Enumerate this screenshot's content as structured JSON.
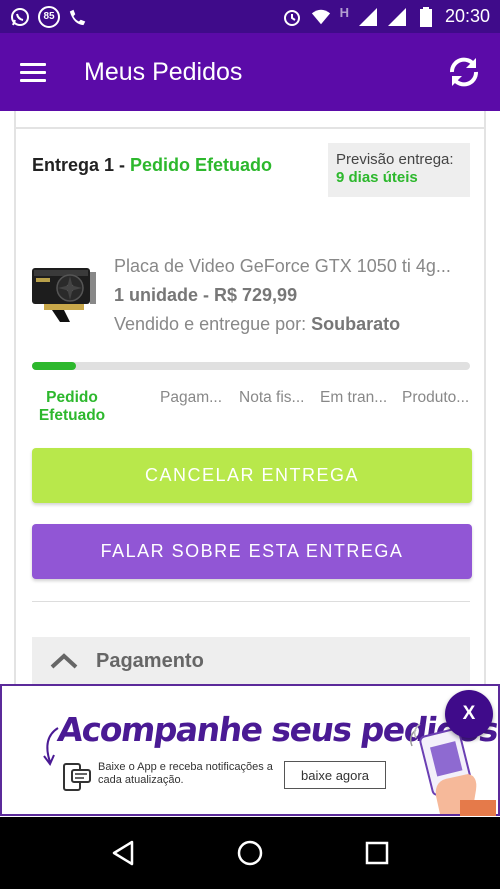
{
  "status_bar": {
    "notification_count": "85",
    "time": "20:30",
    "network_label": "H"
  },
  "app_bar": {
    "title": "Meus Pedidos",
    "menu_icon": "menu-icon",
    "refresh_icon": "refresh-icon"
  },
  "delivery": {
    "label": "Entrega 1 - ",
    "status": "Pedido Efetuado",
    "forecast_label": "Previsão entrega:",
    "forecast_value": "9 dias úteis"
  },
  "product": {
    "name": "Placa de Video GeForce GTX 1050 ti 4g...",
    "quantity_price": "1 unidade - R$ 729,99",
    "seller_label": "Vendido e entregue por: ",
    "seller_name": "Soubarato"
  },
  "progress": {
    "fraction": 0.1,
    "steps": [
      {
        "label": "Pedido Efetuado"
      },
      {
        "label": "Pagam..."
      },
      {
        "label": "Nota fis..."
      },
      {
        "label": "Em tran..."
      },
      {
        "label": "Produto..."
      }
    ]
  },
  "actions": {
    "cancel_label": "CANCELAR ENTREGA",
    "talk_label": "FALAR SOBRE ESTA ENTREGA"
  },
  "payment_section": {
    "label": "Pagamento"
  },
  "banner": {
    "headline": "Acompanhe seus pedidos",
    "description": "Baixe o App e receba notificações a cada atualização.",
    "button_label": "baixe agora",
    "close_label": "X"
  },
  "colors": {
    "app_bar": "#5b0ba8",
    "status_bar": "#3f0b8a",
    "accent_green": "#2db82d",
    "cancel_button": "#b8e84b",
    "talk_button": "#9156d5",
    "banner_purple": "#4a1a94"
  }
}
